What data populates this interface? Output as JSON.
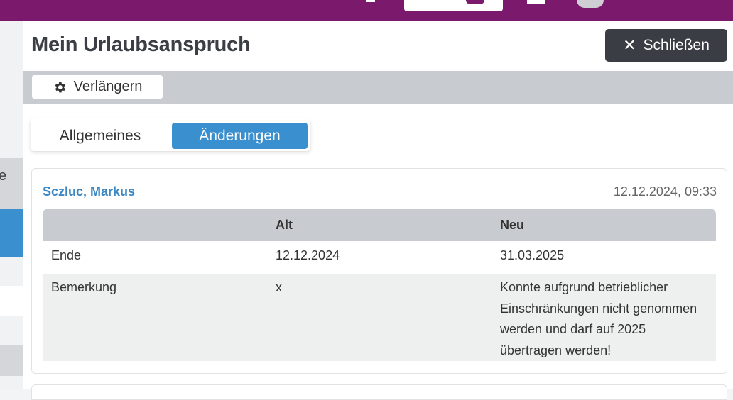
{
  "header": {
    "title": "Mein Urlaubsanspruch",
    "close_label": "Schließen",
    "close_icon": "close-icon"
  },
  "toolbar": {
    "extend_label": "Verlängern",
    "extend_icon": "gear-icon"
  },
  "sidebar": {
    "partial_label": "e"
  },
  "tabs": [
    {
      "label": "Allgemeines",
      "active": false
    },
    {
      "label": "Änderungen",
      "active": true
    }
  ],
  "change_entry": {
    "author": "Sczluc, Markus",
    "timestamp": "12.12.2024, 09:33",
    "columns": [
      "",
      "Alt",
      "Neu"
    ],
    "rows": [
      {
        "field": "Ende",
        "old": "12.12.2024",
        "new": "31.03.2025"
      },
      {
        "field": "Bemerkung",
        "old": "x",
        "new": "Konnte aufgrund betrieblicher Einschränkungen nicht genommen werden und darf auf 2025 übertragen werden!"
      }
    ]
  },
  "colors": {
    "topbar": "#7b1a6c",
    "accent": "#3a8fce",
    "close_button": "#3a3d43",
    "toolbar": "#c8ccd1"
  }
}
